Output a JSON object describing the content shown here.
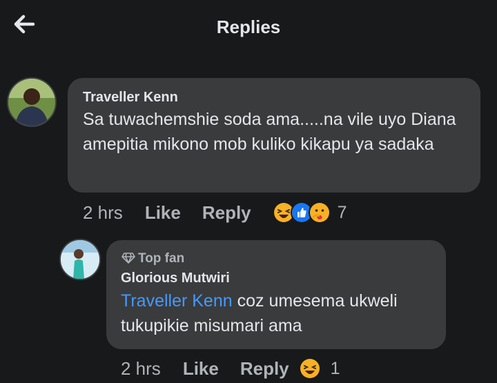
{
  "header": {
    "title": "Replies",
    "back_icon": "arrow-left-icon"
  },
  "comments": [
    {
      "author": "Traveller Kenn",
      "text": "Sa tuwachemshie soda ama.....na vile uyo Diana amepitia mikono mob kuliko kikapu ya sadaka",
      "time": "2 hrs",
      "like_label": "Like",
      "reply_label": "Reply",
      "reactions": [
        "haha",
        "like",
        "care"
      ],
      "reaction_count": "7"
    },
    {
      "badge": "Top fan",
      "author": "Glorious Mutwiri",
      "mention": "Traveller Kenn",
      "text": " coz umesema ukweli tukupikie misumari ama",
      "time": "2 hrs",
      "like_label": "Like",
      "reply_label": "Reply",
      "reactions": [
        "haha"
      ],
      "reaction_count": "1"
    }
  ],
  "colors": {
    "background": "#18191a",
    "bubble": "#3a3b3c",
    "mention": "#4599ff",
    "secondary_text": "#b0b3b8"
  }
}
